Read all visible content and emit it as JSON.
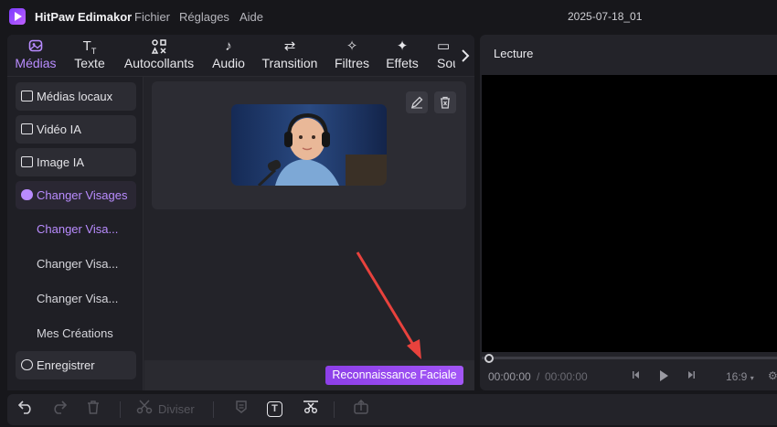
{
  "titlebar": {
    "app_name": "HitPaw Edimakor",
    "menu": [
      "Fichier",
      "Réglages",
      "Aide"
    ],
    "project_name": "2025-07-18_01"
  },
  "top_tabs": [
    {
      "label": "Médias",
      "icon": "media-icon",
      "active": true
    },
    {
      "label": "Texte",
      "icon": "text-icon",
      "active": false
    },
    {
      "label": "Autocollants",
      "icon": "stickers-icon",
      "active": false
    },
    {
      "label": "Audio",
      "icon": "audio-icon",
      "active": false
    },
    {
      "label": "Transition",
      "icon": "transition-icon",
      "active": false
    },
    {
      "label": "Filtres",
      "icon": "filters-icon",
      "active": false
    },
    {
      "label": "Effets",
      "icon": "effects-icon",
      "active": false
    },
    {
      "label": "Sou",
      "icon": "subtitle-icon",
      "active": false
    }
  ],
  "sidebar": {
    "items": [
      {
        "label": "Médias locaux",
        "icon": "folder-icon"
      },
      {
        "label": "Vidéo IA",
        "icon": "ai-video-icon"
      },
      {
        "label": "Image IA",
        "icon": "ai-image-icon"
      },
      {
        "label": "Changer Visages",
        "icon": "face-swap-icon",
        "active": true
      }
    ],
    "sub_items": [
      {
        "label": "Changer Visa...",
        "active": true
      },
      {
        "label": "Changer Visa...",
        "active": false
      },
      {
        "label": "Changer Visa...",
        "active": false
      },
      {
        "label": "Mes Créations",
        "active": false
      }
    ],
    "record": {
      "label": "Enregistrer",
      "icon": "record-icon"
    }
  },
  "content": {
    "face_button": "Reconnaissance Faciale"
  },
  "preview": {
    "title": "Lecture",
    "time_current": "00:00:00",
    "time_separator": "/",
    "time_total": "00:00:00",
    "ratio": "16:9"
  },
  "toolbar": {
    "split_label": "Diviser"
  },
  "colors": {
    "accent": "#b98cff",
    "button_gradient_start": "#8d3fe8",
    "arrow": "#e8423d",
    "background": "#17171b"
  }
}
